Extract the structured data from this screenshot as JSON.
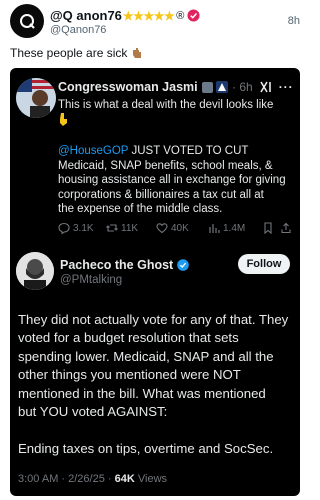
{
  "post": {
    "author_name": "@Q anon76",
    "author_stars": "★★★★★",
    "author_reg": "®",
    "handle": "@Qanon76",
    "time": "8h",
    "text": "These people are sick"
  },
  "quoted": {
    "name": "Congresswoman Jasmin...",
    "time": "· 6h",
    "more": "···",
    "intro_lines": [
      "This is what a deal with the devil looks like"
    ],
    "mention": "@HouseGOP",
    "first_line_rest": " JUST VOTED TO CUT",
    "body_lines": [
      "Medicaid, SNAP benefits, school meals, &",
      "housing assistance all in exchange for giving",
      "corporations & billionaires a tax cut all at",
      "the  expense of the middle class."
    ],
    "metrics": {
      "replies": "3.1K",
      "reposts": "11K",
      "likes": "40K",
      "views": "1.4M"
    }
  },
  "reply": {
    "name": "Pacheco the Ghost",
    "handle": "@PMtalking",
    "follow_label": "Follow",
    "lines": [
      "They did not actually vote for any of that. They",
      "voted for a budget resolution that sets",
      "spending lower. Medicaid, SNAP and all the",
      "other things you mentioned were NOT",
      "mentioned in the bill. What was mentioned",
      "but YOU voted AGAINST:"
    ],
    "last_line": "Ending taxes on tips, overtime and SocSec.",
    "timestamp": "3:00 AM · 2/26/25 · ",
    "views_count": "64K",
    "views_label": " Views"
  },
  "colors": {
    "accent_blue": "#1d9bf0",
    "dark_bg": "#000000",
    "star_yellow": "#f5c518",
    "badge_pink": "#e0245e"
  },
  "icons": [
    "verified-pink-badge-icon",
    "pointing-hand-emoji-icon",
    "us-flag-avatar-icon",
    "government-badge-icon",
    "triangle-affiliation-icon",
    "grok-icon",
    "more-icon",
    "reply-icon",
    "repost-icon",
    "like-icon",
    "views-icon",
    "bookmark-icon",
    "share-icon",
    "blue-check-icon"
  ]
}
